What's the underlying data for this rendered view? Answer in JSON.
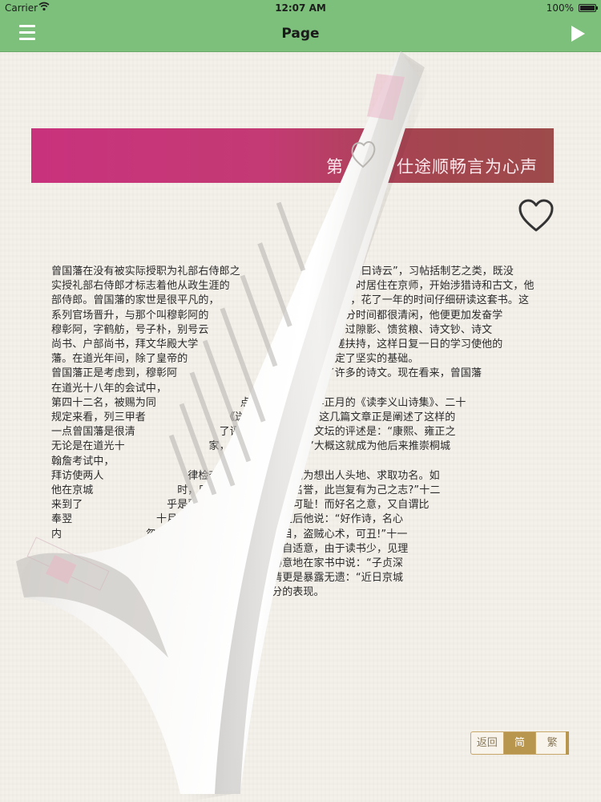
{
  "status": {
    "carrier": "Carrier",
    "time": "12:07 AM",
    "battery": "100%"
  },
  "nav": {
    "title": "Page"
  },
  "chapter": {
    "title": "第　　：仕途顺畅言为心声"
  },
  "body_lines": [
    "曾国藩在没有被实际授职为礼部右侍郎之　　　　　　　　　读“子曰诗云”，习帖括制艺之类，既没",
    "实授礼部右侍郎才标志着他从政生涯的　　　　　　　　　　他暂时居住在京师，开始涉猎诗和古文，他",
    "部侍郎。曾国藩的家世是很平凡的，　　　　　　　　　　　三史，花了一年的时间仔细研读这套书。这",
    "系列官场晋升，与那个叫穆彰阿的　　　　　　　　　后，大部分时间都很清闲，他便更加发奋学",
    "穆彰阿，字鹤舫，号子朴，别号云　　　　　　　　　徐偶谈、过隙影、馈贫粮、诗文钞、诗文",
    "尚书、户部尚书，拜文华殿大学　　　　　　　　　相互间切磋扶持，这样日复一日的学习使他的",
    "藩。在道光年间，除了皇帝的　　　　　　　　　一代大儒奠定了坚实的基础。",
    "曾国藩正是考虑到，穆彰阿　　　　　　　　　诗，因此写了许多的诗文。现在看来，曾国藩",
    "在道光十八年的会试中，　　　　　　　　　这段时间。",
    "第四十二名，被赐为同　　　　　　　　点，道光二十三年正月的《读李义山诗集》、二十",
    "规定来看，列三甲者　　　　　　　　《送周荇农南归序》这几篇文章正是阐述了这样的",
    "一点曾国藩是很清　　　　　　　　了评述，其中对清初文坛的评述是：“康熙、雍正之",
    "无论是在道光十　　　　　　　　家，而方氏最为无类。”大概这就成为他后来推崇桐城",
    "翰詹考试中，　　　　　　　　",
    "拜访使两人　　　　　　　　律检查自己写诗是否是因为想出人头地、求取功名。如",
    "他在京城　　　　　　　　时，只要压倒他人，要取名誉，此岂复有为己之志?”十二",
    "来到了　　　　　　　　乎是要人说好。为人好名，可耻！而好名之意，又自谓比",
    "奉翌　　　　　　　　十月二十五日经过深刻反省之后他说：“好作诗，名心",
    "内　　　　　　　　忽思构一巨篇以震炫举世之耳目，盗贼心术，可丑!”十一",
    "　　　　　　　　处，欲与之谈诗。凡有所作，辄自适意，由于读书少，见理",
    "　　　　　　　一年的十月二十六日那天，他很得意地在家书中说：“子贞深",
    "　　　　　　　一月十七日的家书中他的得意之情更是暴露无遗：“近日京城",
    "　　　　　　　面前，他的求名思想得到了最充分的表现。"
  ],
  "toggle": {
    "back": "返回",
    "simplified": "简",
    "traditional": "繁"
  },
  "curl_back_labels": [
    "返回",
    "简",
    "繁"
  ],
  "colors": {
    "nav": "#7cc07b",
    "banner_left": "#c8327d",
    "banner_right": "#9d4b4b",
    "toggle_active": "#b8964e"
  }
}
